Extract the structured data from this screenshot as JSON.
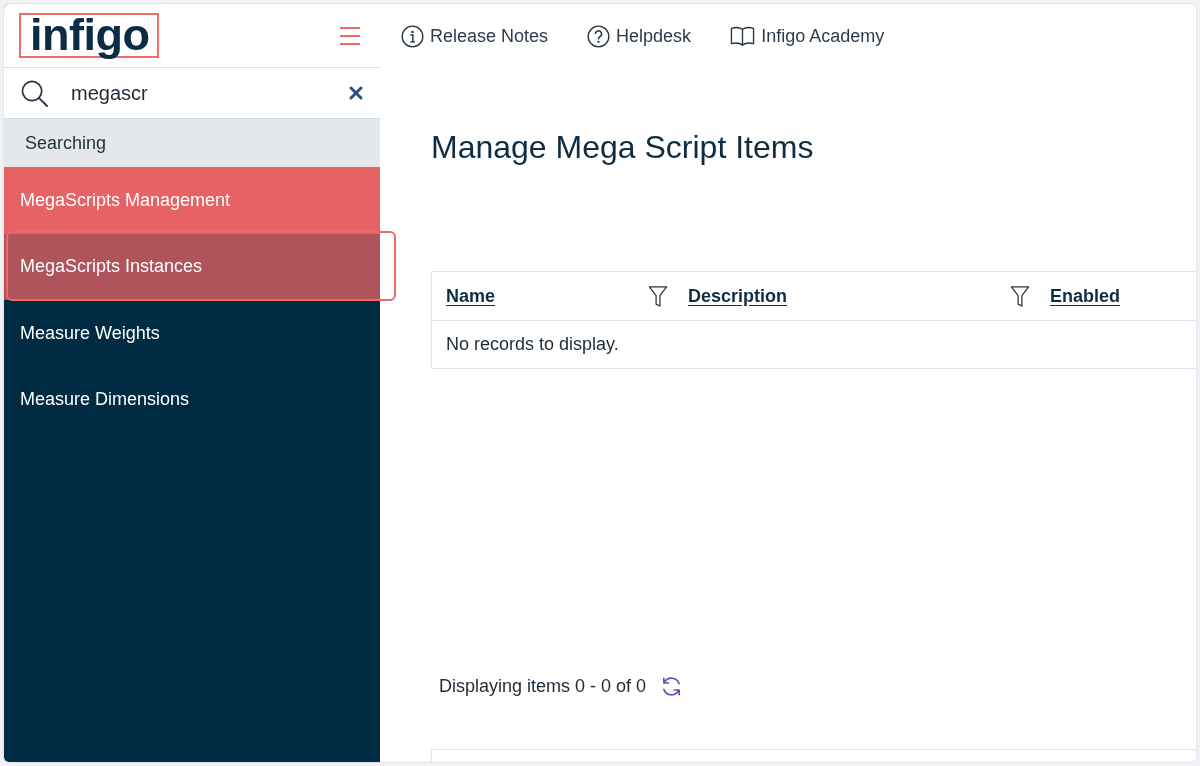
{
  "sidebar": {
    "logo": "infigo",
    "search": {
      "value": "megascr"
    },
    "section_label": "Searching",
    "items": [
      {
        "label": "MegaScripts Management",
        "selected": true,
        "hovered": false,
        "highlighted": false
      },
      {
        "label": "MegaScripts Instances",
        "selected": false,
        "hovered": true,
        "highlighted": true
      },
      {
        "label": "Measure Weights",
        "selected": false,
        "hovered": false,
        "highlighted": false
      },
      {
        "label": "Measure Dimensions",
        "selected": false,
        "hovered": false,
        "highlighted": false
      }
    ]
  },
  "top_links": [
    {
      "label": "Release Notes",
      "kind": "info"
    },
    {
      "label": "Helpdesk",
      "kind": "help"
    },
    {
      "label": "Infigo Academy",
      "kind": "book"
    }
  ],
  "page_title": "Manage Mega Script Items",
  "table": {
    "columns": [
      {
        "label": "Name",
        "filter": true
      },
      {
        "label": "Description",
        "filter": true
      },
      {
        "label": "Enabled",
        "filter": false
      }
    ],
    "empty_message": "No records to display."
  },
  "pager": {
    "summary": "Displaying items 0 - 0 of 0"
  }
}
